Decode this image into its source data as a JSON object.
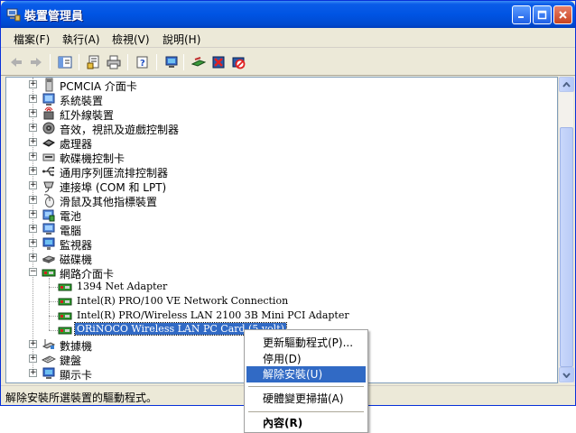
{
  "window": {
    "title": "裝置管理員"
  },
  "menu": [
    "檔案(F)",
    "執行(A)",
    "檢視(V)",
    "說明(H)"
  ],
  "toolbar": {
    "buttons": [
      "back-icon",
      "forward-icon",
      "show-hide-console-tree-icon",
      "properties-icon",
      "print-icon",
      "help-icon",
      "computer-icon",
      "update-driver-icon",
      "uninstall-icon",
      "disable-icon"
    ]
  },
  "tree": {
    "categories_top": [
      "PCMCIA 介面卡",
      "系統裝置",
      "紅外線裝置",
      "音效，視訊及遊戲控制器",
      "處理器",
      "軟碟機控制卡",
      "通用序列匯流排控制器",
      "連接埠 (COM 和 LPT)",
      "滑鼠及其他指標裝置",
      "電池",
      "電腦",
      "監視器",
      "磁碟機"
    ],
    "expanded_category": "網路介面卡",
    "network_adapters": [
      "1394 Net Adapter",
      "Intel(R) PRO/100 VE Network Connection",
      "Intel(R) PRO/Wireless LAN 2100 3B Mini PCI Adapter",
      "ORiNOCO Wireless LAN PC Card (5 volt)"
    ],
    "categories_bottom": [
      "數據機",
      "鍵盤",
      "顯示卡"
    ]
  },
  "context_menu": {
    "items": [
      "更新驅動程式(P)...",
      "停用(D)",
      "解除安裝(U)",
      "硬體變更掃描(A)",
      "內容(R)"
    ]
  },
  "status": {
    "text": "解除安裝所選裝置的驅動程式。"
  },
  "colors": {
    "title_bar": "#0054e3",
    "selection": "#316ac5",
    "chrome": "#ece9d8"
  }
}
